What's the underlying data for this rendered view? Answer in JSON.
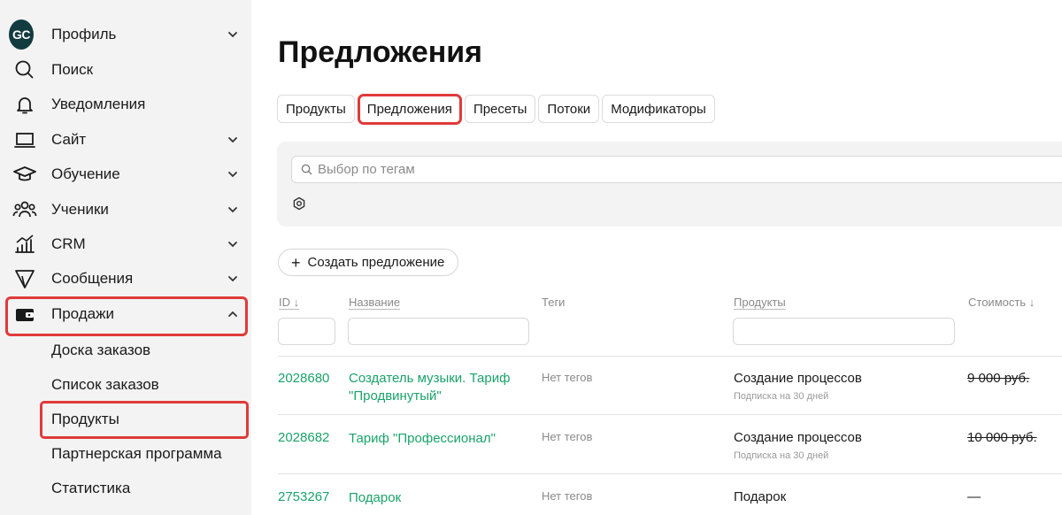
{
  "sidebar": {
    "profile": {
      "avatar_text": "GC",
      "label": "Профиль"
    },
    "items": [
      {
        "label": "Поиск",
        "icon": "search-icon"
      },
      {
        "label": "Уведомления",
        "icon": "bell-icon"
      },
      {
        "label": "Сайт",
        "icon": "laptop-icon"
      },
      {
        "label": "Обучение",
        "icon": "graduation-cap-icon"
      },
      {
        "label": "Ученики",
        "icon": "users-icon"
      },
      {
        "label": "CRM",
        "icon": "chart-icon"
      },
      {
        "label": "Сообщения",
        "icon": "send-icon"
      },
      {
        "label": "Продажи",
        "icon": "wallet-icon"
      }
    ],
    "sales_sub": [
      "Доска заказов",
      "Список заказов",
      "Продукты",
      "Партнерская программа",
      "Статистика"
    ]
  },
  "main": {
    "title": "Предложения",
    "tabs": [
      "Продукты",
      "Предложения",
      "Пресеты",
      "Потоки",
      "Модификаторы"
    ],
    "active_tab": "Предложения",
    "search_placeholder": "Выбор по тегам",
    "create_label": "Создать предложение",
    "columns": {
      "id": "ID ↓",
      "name": "Название",
      "tags": "Теги",
      "products": "Продукты",
      "price": "Стоимость ↓"
    },
    "rows": [
      {
        "id": "2028680",
        "name": "Создатель музыки. Тариф \"Продвинутый\"",
        "tags": "Нет тегов",
        "product": "Создание процессов",
        "product_sub": "Подписка на 30 дней",
        "price": "9 000 руб."
      },
      {
        "id": "2028682",
        "name": "Тариф \"Профессионал\"",
        "tags": "Нет тегов",
        "product": "Создание процессов",
        "product_sub": "Подписка на 30 дней",
        "price": "10 000 руб."
      },
      {
        "id": "2753267",
        "name": "Подарок",
        "tags": "Нет тегов",
        "product": "Подарок",
        "product_sub": "",
        "price": "—"
      }
    ]
  },
  "colors": {
    "accent_green": "#1aa36a",
    "highlight_red": "#e03a3a",
    "avatar_bg": "#123b3f"
  }
}
